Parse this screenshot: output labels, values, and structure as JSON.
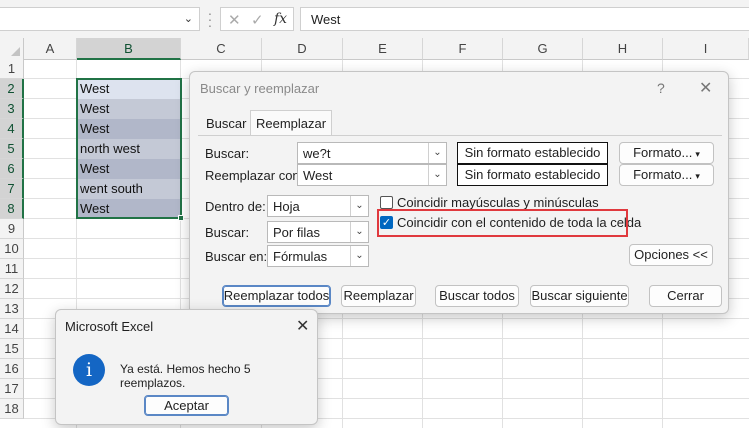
{
  "formula_bar": {
    "name_box_value": "",
    "cancel_icon": "✕",
    "enter_icon": "✓",
    "fx_label": "fx",
    "formula_value": "West"
  },
  "grid": {
    "columns": [
      "A",
      "B",
      "C",
      "D",
      "E",
      "F",
      "G",
      "H",
      "I"
    ],
    "rows": [
      "1",
      "2",
      "3",
      "4",
      "5",
      "6",
      "7",
      "8",
      "9",
      "10",
      "11",
      "12",
      "13",
      "14",
      "15",
      "16",
      "17",
      "18"
    ],
    "selected_column": "B",
    "b_values": [
      "West",
      "West",
      "West",
      "north west",
      "West",
      "went south",
      "West"
    ]
  },
  "dialog": {
    "title": "Buscar y reemplazar",
    "help": "?",
    "close": "✕",
    "tabs": {
      "find": "Buscar",
      "replace": "Reemplazar"
    },
    "find_label": "Buscar:",
    "find_value": "we?t",
    "replace_label": "Reemplazar con:",
    "replace_value": "West",
    "no_format": "Sin formato establecido",
    "format_button": "Formato...",
    "within_label": "Dentro de:",
    "within_value": "Hoja",
    "search_label": "Buscar:",
    "search_value": "Por filas",
    "lookin_label": "Buscar en:",
    "lookin_value": "Fórmulas",
    "match_case": "Coincidir mayúsculas y minúsculas",
    "match_entire": "Coincidir con el contenido de toda la celda",
    "match_case_checked": false,
    "match_entire_checked": true,
    "options_button": "Opciones <<",
    "replace_all": "Reemplazar todos",
    "replace": "Reemplazar",
    "find_all": "Buscar todos",
    "find_next": "Buscar siguiente",
    "close_button": "Cerrar",
    "check_mark": "✓"
  },
  "message": {
    "title": "Microsoft Excel",
    "close": "✕",
    "icon": "i",
    "text": "Ya está. Hemos hecho 5 reemplazos.",
    "ok": "Aceptar"
  },
  "colors": {
    "excel_green": "#217346",
    "highlight_red": "#e0393e",
    "checkbox_blue": "#0067c0",
    "info_blue": "#1466c4"
  }
}
